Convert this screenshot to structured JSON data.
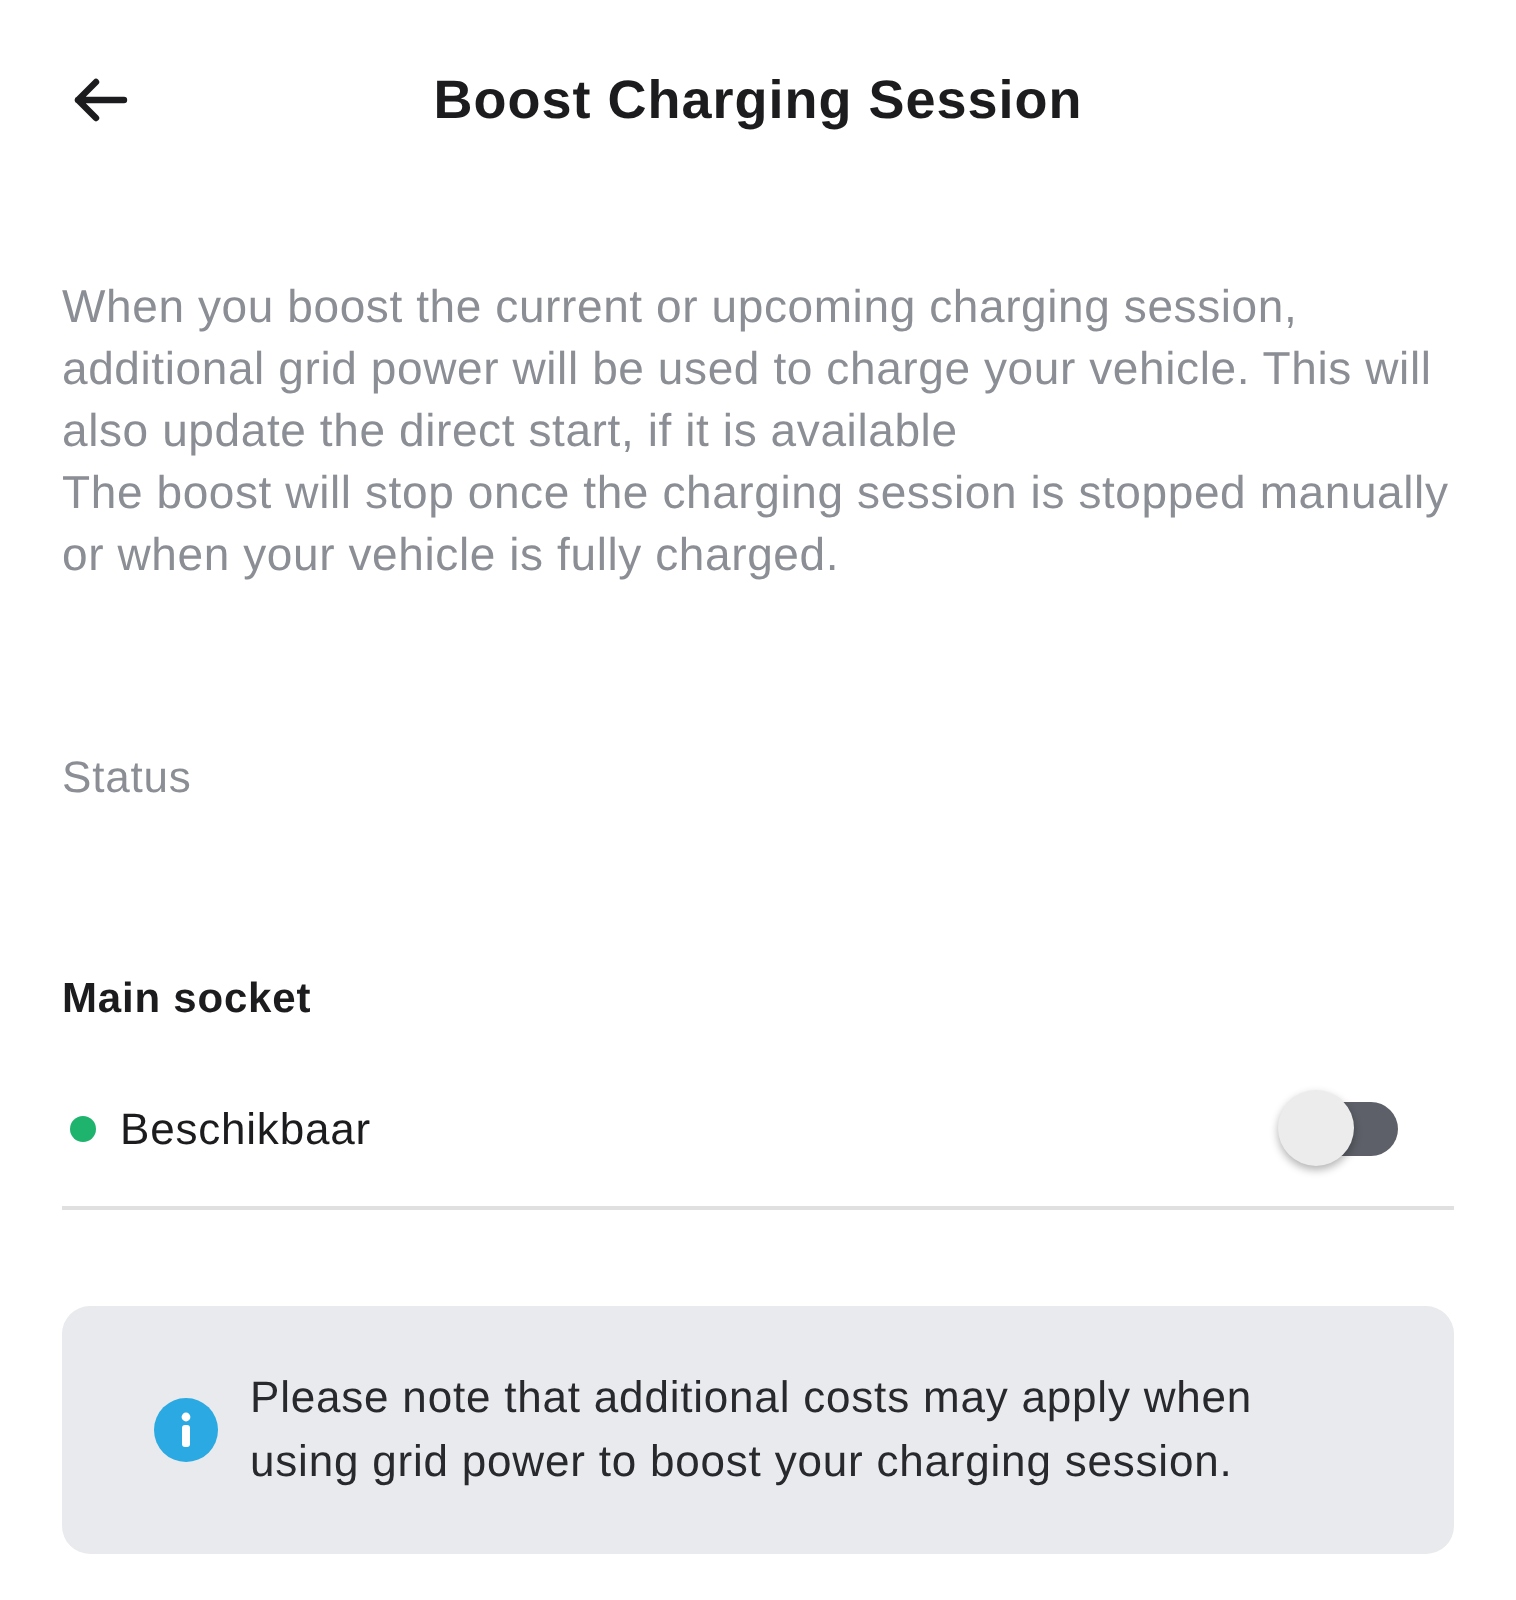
{
  "header": {
    "title": "Boost Charging Session"
  },
  "description": [
    "When you boost the current or upcoming charging session, additional grid power will be used to charge your vehicle. This will also update the direct start, if it is available",
    "The boost will stop once the charging session is stopped manually or when your vehicle is fully charged."
  ],
  "status_label": "Status",
  "sockets": [
    {
      "name": "Main socket",
      "status": "Beschikbaar",
      "color": "#1fb46d",
      "boost_on": false
    }
  ],
  "notice": {
    "text": "Please note that additional costs may apply when using grid power to boost your charging session."
  }
}
